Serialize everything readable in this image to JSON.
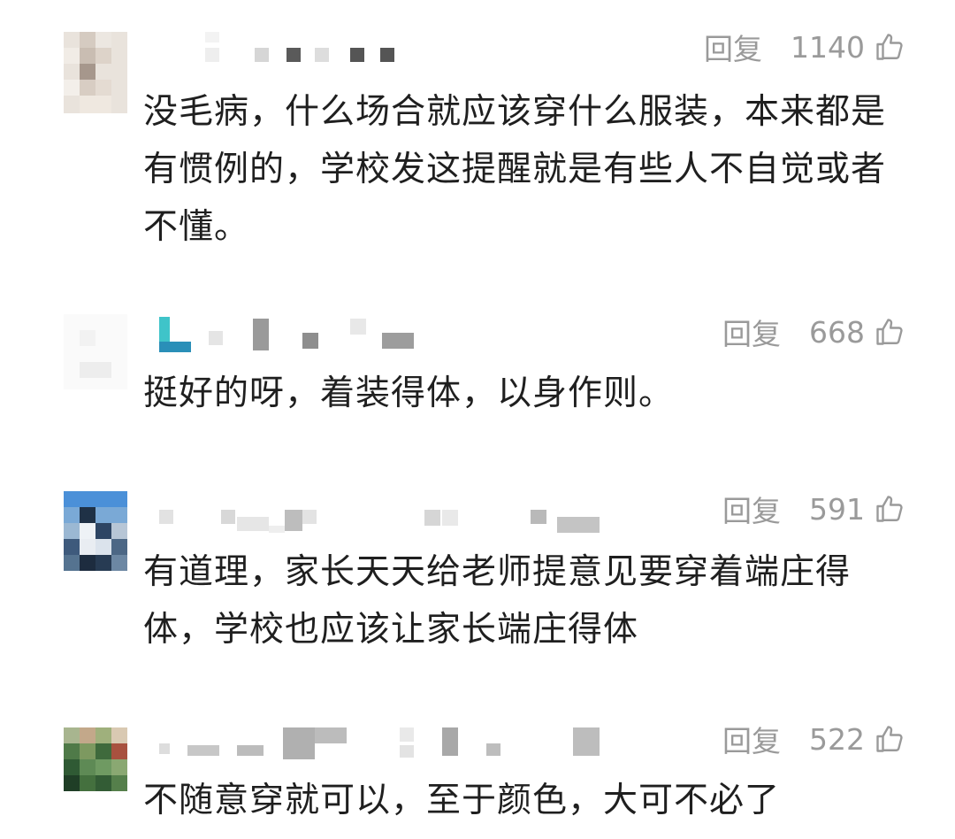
{
  "comments": [
    {
      "reply_label": "回复",
      "likes": "1140",
      "text_lines": [
        "没毛病，什么场合就应该穿什么服装，本来都是",
        "有惯例的，学校发这提醒就是有些人不自觉或者",
        "不懂。"
      ]
    },
    {
      "reply_label": "回复",
      "likes": "668",
      "text_lines": [
        "挺好的呀，着装得体，以身作则。"
      ]
    },
    {
      "reply_label": "回复",
      "likes": "591",
      "text_lines": [
        "有道理，家长天天给老师提意见要穿着端庄得",
        "体，学校也应该让家长端庄得体"
      ]
    },
    {
      "reply_label": "回复",
      "likes": "522",
      "text_lines": [
        "不随意穿就可以，至于颜色，大可不必了"
      ]
    }
  ],
  "icons": {
    "like": "thumbs-up-outline-icon"
  },
  "colors": {
    "text": "#1f1f1f",
    "meta": "#9a9a9a",
    "background": "#ffffff"
  }
}
